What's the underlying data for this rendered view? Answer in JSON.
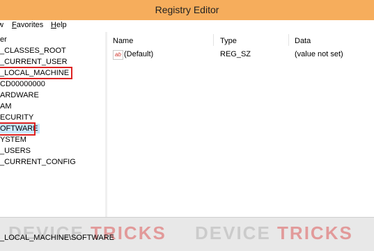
{
  "window": {
    "title": "Registry Editor"
  },
  "menu": {
    "view": "w",
    "favorites": "Favorites",
    "help": "Help"
  },
  "tree": {
    "root": "er",
    "nodes": [
      "_CLASSES_ROOT",
      "_CURRENT_USER",
      "_LOCAL_MACHINE",
      "CD00000000",
      "ARDWARE",
      "AM",
      "ECURITY",
      "OFTWARE",
      "YSTEM",
      "_USERS",
      "_CURRENT_CONFIG"
    ]
  },
  "list": {
    "columns": [
      "Name",
      "Type",
      "Data"
    ],
    "rows": [
      {
        "icon": "ab",
        "name": "(Default)",
        "type": "REG_SZ",
        "data": "(value not set)"
      }
    ]
  },
  "status": {
    "path": "_LOCAL_MACHINE\\SOFTWARE",
    "watermark": [
      "DEVICE",
      "TRICKS"
    ]
  },
  "colors": {
    "titlebar": "#f6ad5c",
    "highlight_box": "#dd2222",
    "selection": "#cce8ff"
  }
}
